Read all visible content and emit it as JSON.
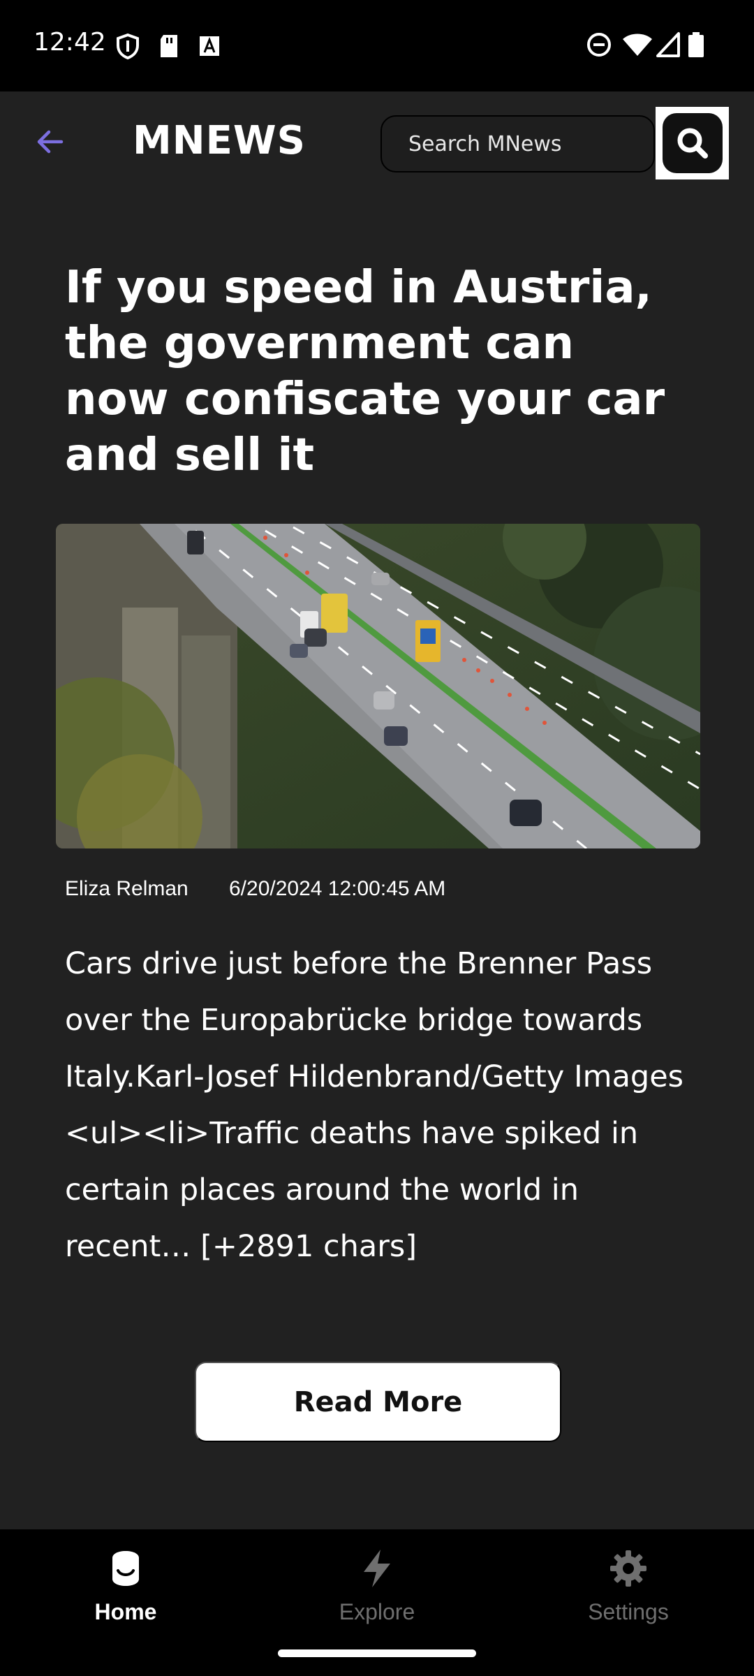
{
  "status_bar": {
    "time": "12:42",
    "left_icons": [
      "shield-icon",
      "sd-card-icon",
      "text-a-icon"
    ],
    "right_icons": [
      "do-not-disturb-icon",
      "wifi-icon",
      "signal-icon",
      "battery-icon"
    ]
  },
  "header": {
    "brand": "MNEWS",
    "search_placeholder": "Search MNews",
    "accent_color": "#7c6fe0"
  },
  "article": {
    "title": "If you speed in Austria, the government can now confiscate your car and sell it",
    "author": "Eliza Relman",
    "date": "6/20/2024 12:00:45 AM",
    "body": "Cars drive just before the Brenner Pass over the Europabrücke bridge towards Italy.Karl-Josef Hildenbrand/Getty Images\n<ul><li>Traffic deaths have spiked in certain places around the world in recent… [+2891 chars]",
    "read_more_label": "Read More"
  },
  "bottom_nav": {
    "items": [
      {
        "label": "Home",
        "icon": "home-icon",
        "active": true
      },
      {
        "label": "Explore",
        "icon": "lightning-icon",
        "active": false
      },
      {
        "label": "Settings",
        "icon": "gear-icon",
        "active": false
      }
    ]
  }
}
